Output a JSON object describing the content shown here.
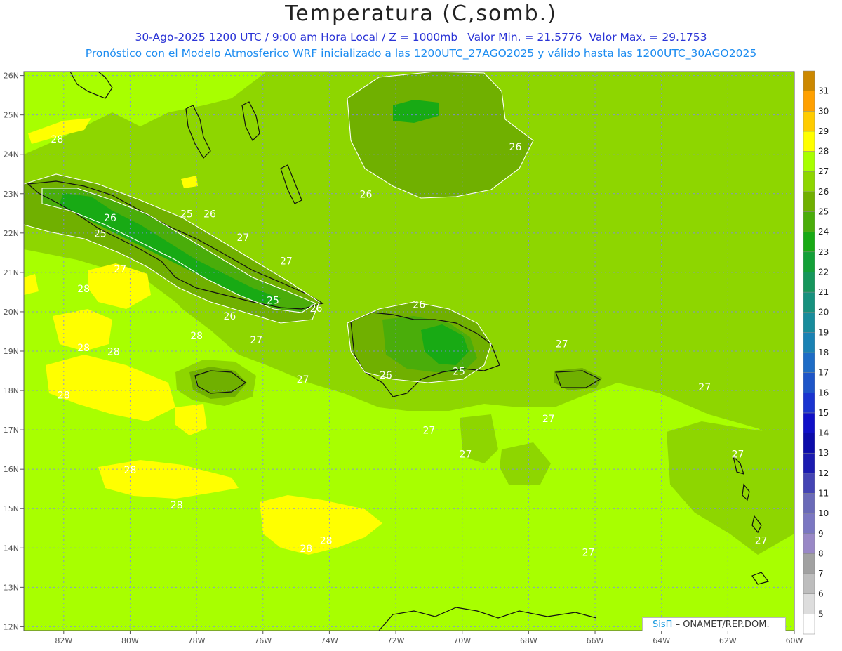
{
  "header": {
    "title": "Temperatura (C,somb.)",
    "date_line": "30-Ago-2025  1200 UTC / 9:00 am Hora Local / Z = 1000mb",
    "min_label": "Valor Min. = 21.5776",
    "max_label": "Valor Max. = 29.1753",
    "forecast_line": "Pronóstico con el Modelo Atmosferico WRF inicializado a las 1200UTC_27AGO2025 y válido hasta las  1200UTC_30AGO2025"
  },
  "map": {
    "lon_range": [
      -83.2,
      -60
    ],
    "lat_range": [
      11.9,
      26.1
    ],
    "lon_ticks": [
      "82W",
      "80W",
      "78W",
      "76W",
      "74W",
      "72W",
      "70W",
      "68W",
      "66W",
      "64W",
      "62W",
      "60W"
    ],
    "lat_ticks": [
      "26N",
      "25N",
      "24N",
      "23N",
      "22N",
      "21N",
      "20N",
      "19N",
      "18N",
      "17N",
      "16N",
      "15N",
      "14N",
      "13N",
      "12N"
    ],
    "grid": true,
    "background_color": "#a8ff00",
    "contour_labels": [
      {
        "text": "28",
        "lon": -82.2,
        "lat": 24.3
      },
      {
        "text": "26",
        "lon": -80.6,
        "lat": 22.3
      },
      {
        "text": "25",
        "lon": -78.3,
        "lat": 22.4
      },
      {
        "text": "26",
        "lon": -77.6,
        "lat": 22.4
      },
      {
        "text": "25",
        "lon": -80.9,
        "lat": 21.9
      },
      {
        "text": "27",
        "lon": -80.3,
        "lat": 21.0
      },
      {
        "text": "27",
        "lon": -76.6,
        "lat": 21.8
      },
      {
        "text": "27",
        "lon": -75.3,
        "lat": 21.2
      },
      {
        "text": "28",
        "lon": -81.4,
        "lat": 20.5
      },
      {
        "text": "25",
        "lon": -75.7,
        "lat": 20.2
      },
      {
        "text": "26",
        "lon": -77.0,
        "lat": 19.8
      },
      {
        "text": "26",
        "lon": -74.4,
        "lat": 20.0
      },
      {
        "text": "28",
        "lon": -78.0,
        "lat": 19.3
      },
      {
        "text": "27",
        "lon": -76.2,
        "lat": 19.2
      },
      {
        "text": "26",
        "lon": -71.3,
        "lat": 20.1
      },
      {
        "text": "28",
        "lon": -81.4,
        "lat": 19.0
      },
      {
        "text": "28",
        "lon": -80.5,
        "lat": 18.9
      },
      {
        "text": "27",
        "lon": -74.8,
        "lat": 18.2
      },
      {
        "text": "26",
        "lon": -72.3,
        "lat": 18.3
      },
      {
        "text": "25",
        "lon": -70.1,
        "lat": 18.4
      },
      {
        "text": "27",
        "lon": -67.0,
        "lat": 19.1
      },
      {
        "text": "27",
        "lon": -62.7,
        "lat": 18.0
      },
      {
        "text": "28",
        "lon": -82.0,
        "lat": 17.8
      },
      {
        "text": "27",
        "lon": -71.0,
        "lat": 16.9
      },
      {
        "text": "27",
        "lon": -67.4,
        "lat": 17.2
      },
      {
        "text": "27",
        "lon": -69.9,
        "lat": 16.3
      },
      {
        "text": "27",
        "lon": -61.7,
        "lat": 16.3
      },
      {
        "text": "28",
        "lon": -80.0,
        "lat": 15.9
      },
      {
        "text": "28",
        "lon": -78.6,
        "lat": 15.0
      },
      {
        "text": "28",
        "lon": -74.1,
        "lat": 14.1
      },
      {
        "text": "28",
        "lon": -74.7,
        "lat": 13.9
      },
      {
        "text": "27",
        "lon": -66.2,
        "lat": 13.8
      },
      {
        "text": "27",
        "lon": -61.0,
        "lat": 14.1
      },
      {
        "text": "26",
        "lon": -68.4,
        "lat": 24.1
      },
      {
        "text": "26",
        "lon": -72.9,
        "lat": 22.9
      }
    ]
  },
  "colorbar": {
    "labels": [
      "5",
      "6",
      "7",
      "8",
      "9",
      "10",
      "11",
      "12",
      "13",
      "14",
      "15",
      "16",
      "17",
      "18",
      "19",
      "20",
      "21",
      "22",
      "23",
      "24",
      "25",
      "26",
      "27",
      "28",
      "29",
      "30",
      "31"
    ],
    "colors": [
      "#ffffff",
      "#dddddd",
      "#bdbdbd",
      "#a1a1a1",
      "#9988c6",
      "#7b77c2",
      "#6a6ab8",
      "#4444b4",
      "#1b1bb0",
      "#0c0caa",
      "#1010c8",
      "#1a34d0",
      "#1e55c8",
      "#1e6cc6",
      "#1a82b4",
      "#188c9c",
      "#17917e",
      "#16965c",
      "#13a038",
      "#18aa14",
      "#4aad0a",
      "#70b000",
      "#8ed600",
      "#a8ff00",
      "#ffff00",
      "#ffcc00",
      "#ffa000",
      "#cc8800"
    ]
  },
  "credit": {
    "brand": "SisΠ",
    "text": "– ONAMET/REP.DOM."
  }
}
